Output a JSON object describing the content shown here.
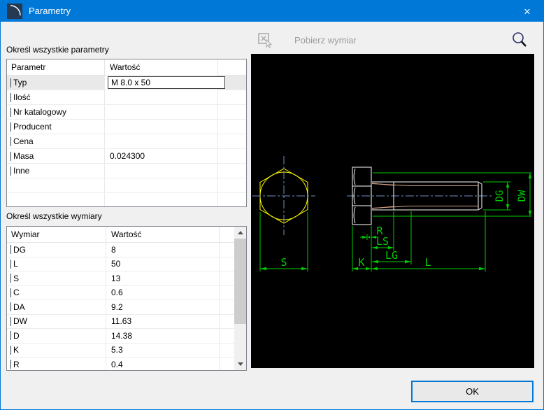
{
  "window": {
    "title": "Parametry",
    "close_glyph": "×"
  },
  "toolbar": {
    "pick_dimension_label": "Pobierz wymiar"
  },
  "parameters": {
    "section_label": "Określ wszystkie parametry",
    "headers": {
      "name": "Parametr",
      "value": "Wartość"
    },
    "rows": [
      {
        "name": "Typ",
        "value": "M 8.0 x 50"
      },
      {
        "name": "Ilość",
        "value": ""
      },
      {
        "name": "Nr katalogowy",
        "value": ""
      },
      {
        "name": "Producent",
        "value": ""
      },
      {
        "name": "Cena",
        "value": ""
      },
      {
        "name": "Masa",
        "value": "0.024300"
      },
      {
        "name": "Inne",
        "value": ""
      }
    ]
  },
  "dimensions": {
    "section_label": "Określ wszystkie wymiary",
    "headers": {
      "name": "Wymiar",
      "value": "Wartość"
    },
    "rows": [
      {
        "name": "DG",
        "value": "8"
      },
      {
        "name": "L",
        "value": "50"
      },
      {
        "name": "S",
        "value": "13"
      },
      {
        "name": "C",
        "value": "0.6"
      },
      {
        "name": "DA",
        "value": "9.2"
      },
      {
        "name": "DW",
        "value": "11.63"
      },
      {
        "name": "D",
        "value": "14.38"
      },
      {
        "name": "K",
        "value": "5.3"
      },
      {
        "name": "R",
        "value": "0.4"
      }
    ]
  },
  "preview": {
    "labels": {
      "s": "S",
      "k": "K",
      "l": "L",
      "lg": "LG",
      "ls": "LS",
      "r": "R",
      "dg": "DG",
      "dw": "DW"
    },
    "colors": {
      "background": "#000000",
      "outline": "#ffffff",
      "hexagon": "#ffff00",
      "dimension": "#00cd00",
      "centerline": "#7090c0",
      "thread": "#d2a285",
      "titlebar": "#0078d7"
    }
  },
  "footer": {
    "ok_label": "OK"
  }
}
